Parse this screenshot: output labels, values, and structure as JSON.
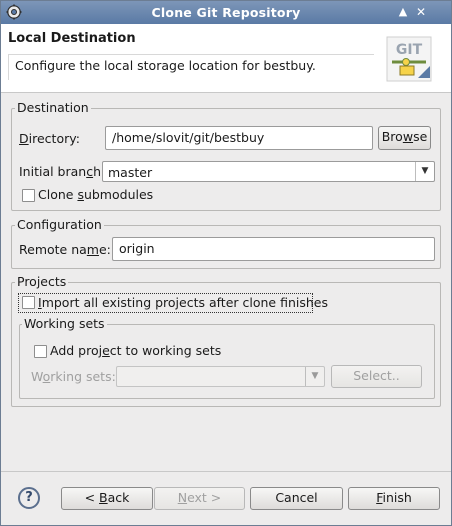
{
  "window": {
    "title": "Clone Git Repository",
    "controls": {
      "minimize": "▲",
      "close": "✕"
    }
  },
  "header": {
    "title": "Local Destination",
    "description": "Configure the local storage location for bestbuy.",
    "logo_text": "GIT"
  },
  "destination": {
    "group_label": "Destination",
    "directory_label_pre": "",
    "directory_label_u": "D",
    "directory_label_post": "irectory:",
    "directory_value": "/home/slovit/git/bestbuy",
    "browse_pre": "Bro",
    "browse_u": "w",
    "browse_post": "se",
    "branch_label_pre": "Initial bran",
    "branch_label_u": "c",
    "branch_label_post": "h:",
    "branch_value": "master",
    "submodules_pre": "Clone ",
    "submodules_u": "s",
    "submodules_post": "ubmodules",
    "submodules_checked": false
  },
  "configuration": {
    "group_label": "Configuration",
    "remote_label_pre": "Remote na",
    "remote_label_u": "m",
    "remote_label_post": "e:",
    "remote_value": "origin"
  },
  "projects": {
    "group_label": "Projects",
    "import_pre": "",
    "import_u": "I",
    "import_post": "mport all existing projects after clone finishes",
    "import_checked": false,
    "working_sets": {
      "group_label": "Working sets",
      "add_pre": "Add proj",
      "add_u": "e",
      "add_post": "ct to working sets",
      "add_checked": false,
      "ws_label_pre": "W",
      "ws_label_u": "o",
      "ws_label_post": "rking sets:",
      "select_label": "Select.."
    }
  },
  "footer": {
    "help_symbol": "?",
    "back_pre": "< ",
    "back_u": "B",
    "back_post": "ack",
    "next_pre": "",
    "next_u": "N",
    "next_post": "ext >",
    "cancel_label": "Cancel",
    "finish_pre": "",
    "finish_u": "F",
    "finish_post": "inish"
  }
}
